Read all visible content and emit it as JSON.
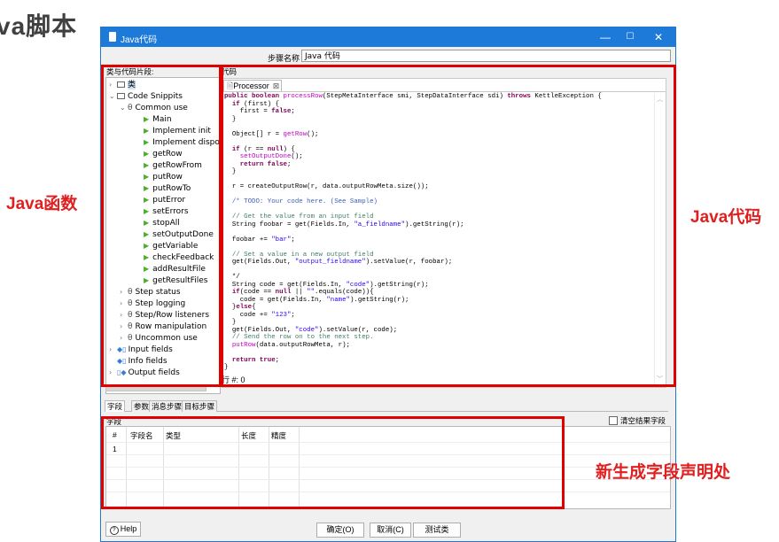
{
  "slide_title": "va脚本",
  "window": {
    "title": "Java代码",
    "controls": [
      "—",
      "☐",
      "✕"
    ]
  },
  "step": {
    "label": "步骤名称",
    "value": "Java 代码"
  },
  "left_panel_label": "类与代码片段:",
  "code_label": "代码",
  "tree": {
    "root_classes": "类",
    "code_snippets": "Code Snippits",
    "common_use": "Common use",
    "common_items": [
      "Main",
      "Implement init",
      "Implement dispose",
      "getRow",
      "getRowFrom",
      "putRow",
      "putRowTo",
      "putError",
      "setErrors",
      "stopAll",
      "setOutputDone",
      "getVariable",
      "checkFeedback",
      "addResultFile",
      "getResultFiles"
    ],
    "groups": [
      "Step status",
      "Step logging",
      "Step/Row listeners",
      "Row manipulation",
      "Uncommon use"
    ],
    "input_fields": "Input fields",
    "info_fields": "Info fields",
    "output_fields": "Output fields"
  },
  "code_tab": "Processor",
  "row_count": "行 #: 0",
  "bottom_tabs": [
    "字段",
    "参数",
    "消息步骤",
    "目标步骤"
  ],
  "fields_label": "字段",
  "clear_checkbox": "清空结果字段",
  "grid": {
    "headers": [
      "#",
      "字段名",
      "类型",
      "长度",
      "精度"
    ],
    "rows": [
      "1"
    ]
  },
  "buttons": {
    "help": "Help",
    "ok": "确定(O)",
    "cancel": "取消(C)",
    "test": "测试类"
  },
  "annotations": {
    "java_functions": "Java函数",
    "java_code": "Java代码",
    "new_fields": "新生成字段声明处"
  },
  "colors": {
    "accent": "#1e7ad8",
    "annotation": "#e00000"
  }
}
